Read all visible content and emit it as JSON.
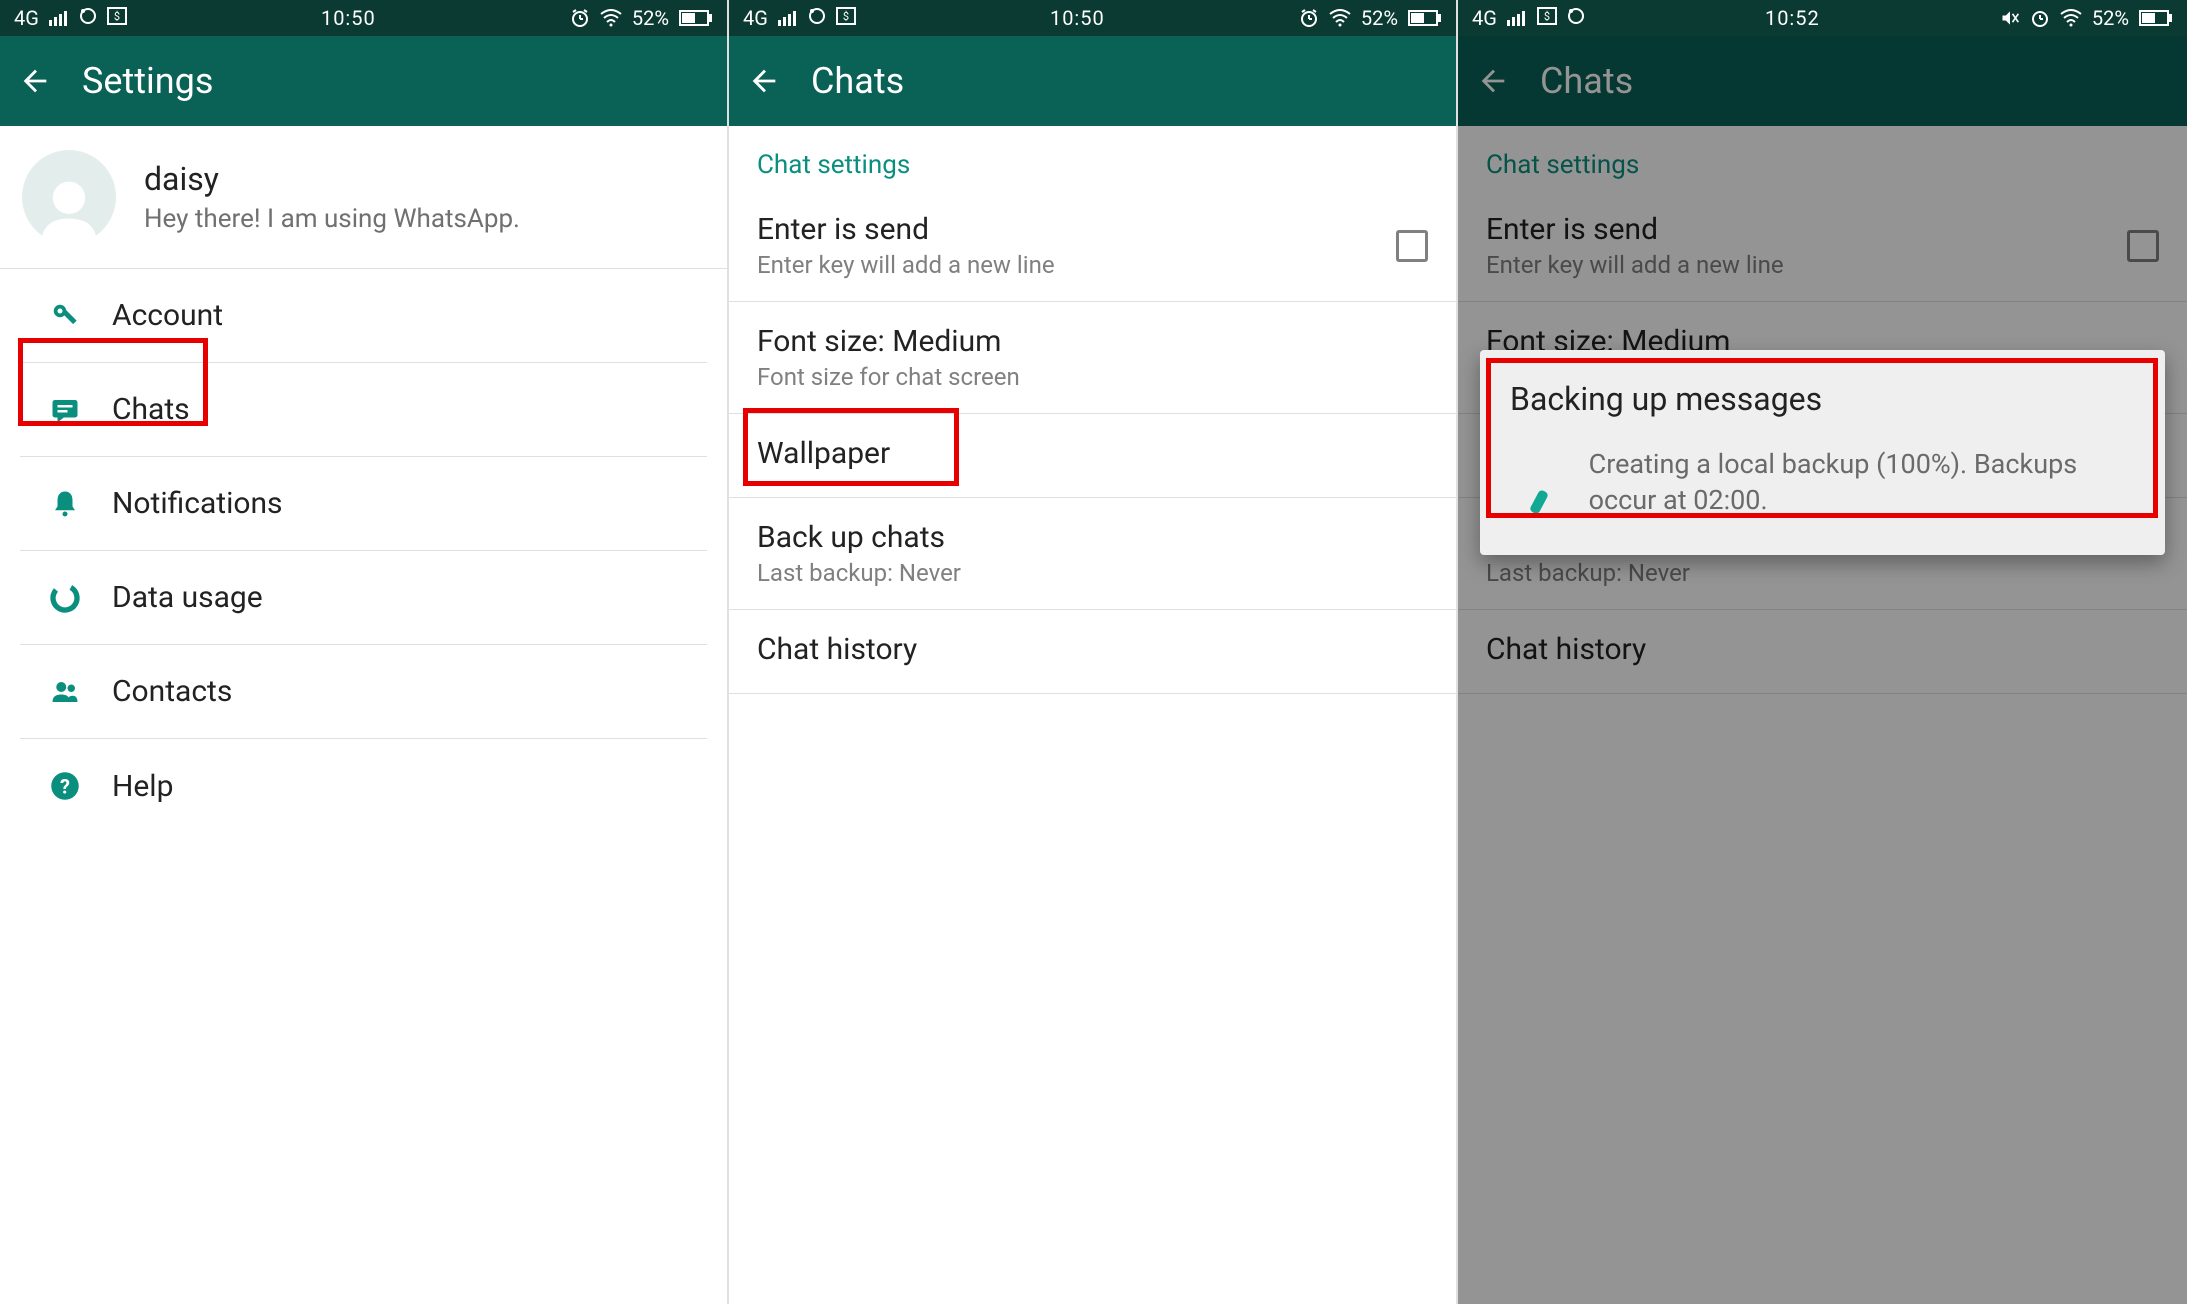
{
  "statusbar": {
    "network": "4G",
    "time1": "10:50",
    "time2": "10:50",
    "time3": "10:52",
    "battery": "52%"
  },
  "screen1": {
    "title": "Settings",
    "profile": {
      "name": "daisy",
      "status": "Hey there! I am using WhatsApp."
    },
    "items": [
      {
        "label": "Account"
      },
      {
        "label": "Chats"
      },
      {
        "label": "Notifications"
      },
      {
        "label": "Data usage"
      },
      {
        "label": "Contacts"
      },
      {
        "label": "Help"
      }
    ]
  },
  "screen2": {
    "title": "Chats",
    "section": "Chat settings",
    "rows": {
      "enter_title": "Enter is send",
      "enter_sub": "Enter key will add a new line",
      "font_title": "Font size: Medium",
      "font_sub": "Font size for chat screen",
      "wallpaper": "Wallpaper",
      "backup_title": "Back up chats",
      "backup_sub": "Last backup: Never",
      "history": "Chat history"
    }
  },
  "screen3": {
    "title": "Chats",
    "section": "Chat settings",
    "dialog": {
      "title": "Backing up messages",
      "text": "Creating a local backup (100%). Backups occur at 02:00."
    }
  },
  "colors": {
    "brand": "#0a6156",
    "accent": "#0a8f7f",
    "highlight": "#e60000"
  }
}
